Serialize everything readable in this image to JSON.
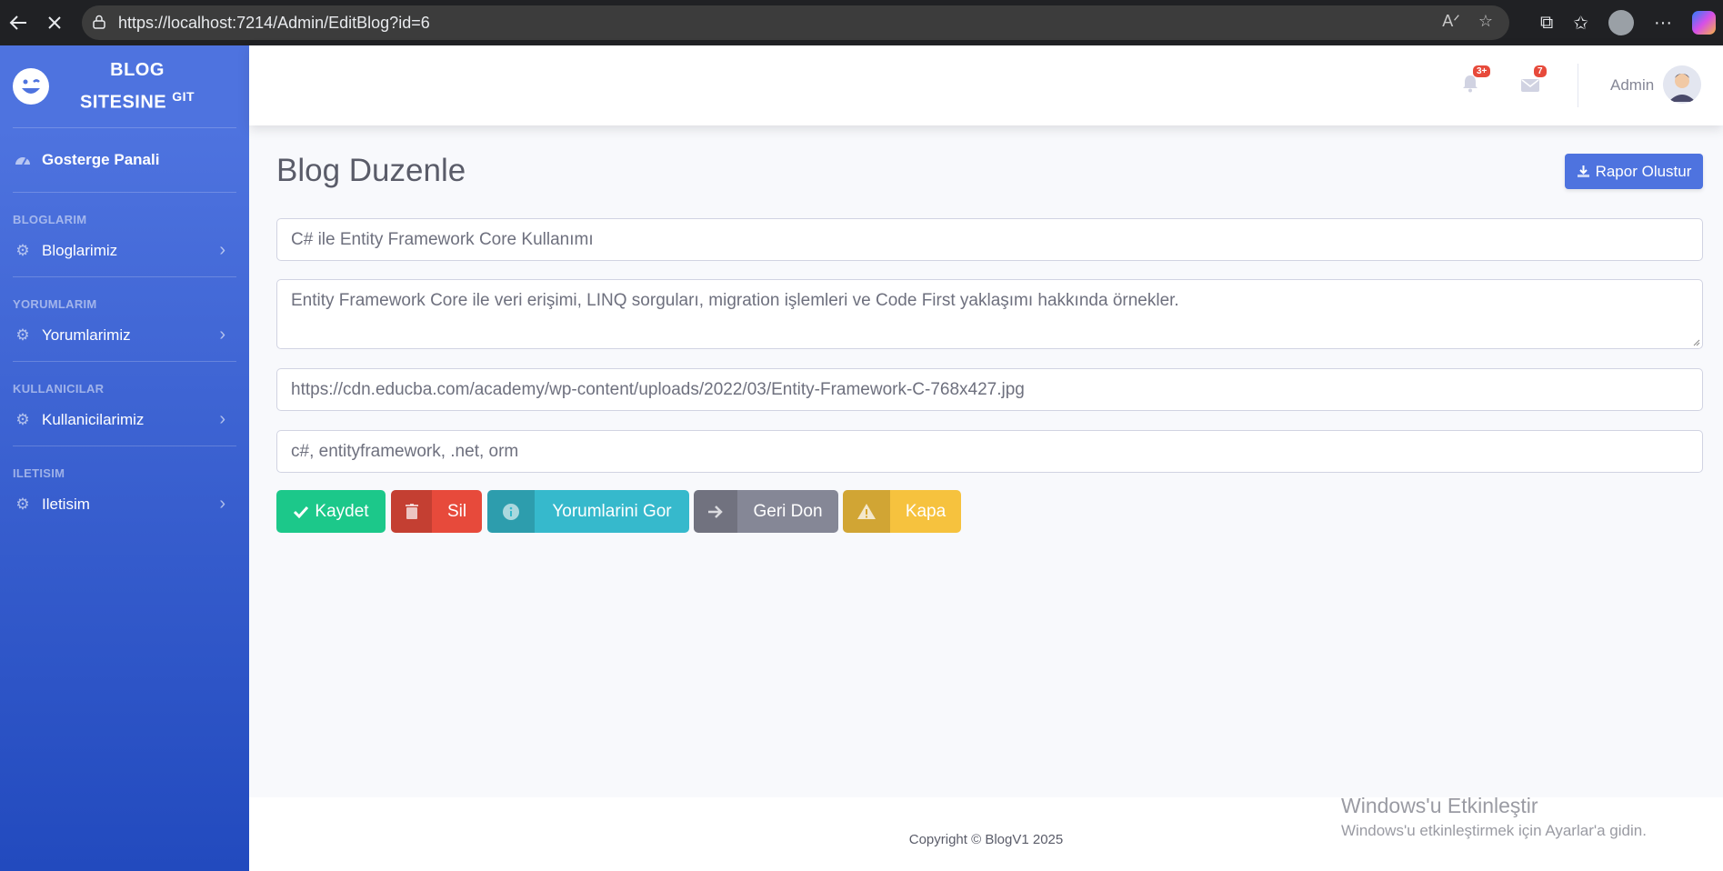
{
  "browser": {
    "url": "https://localhost:7214/Admin/EditBlog?id=6"
  },
  "sidebar": {
    "brand_line1": "BLOG",
    "brand_line2": "SITESINE",
    "brand_sup": "GIT",
    "dashboard": "Gosterge Panali",
    "sections": [
      {
        "heading": "BLOGLARIM",
        "item": "Bloglarimiz"
      },
      {
        "heading": "YORUMLARIM",
        "item": "Yorumlarimiz"
      },
      {
        "heading": "KULLANICILAR",
        "item": "Kullanicilarimiz"
      },
      {
        "heading": "ILETISIM",
        "item": "Iletisim"
      }
    ]
  },
  "topbar": {
    "alerts_badge": "3+",
    "messages_badge": "7",
    "user_name": "Admin"
  },
  "main": {
    "title": "Blog Duzenle",
    "report_button": "Rapor Olustur",
    "form": {
      "title_value": "C# ile Entity Framework Core Kullanımı",
      "content_value": "Entity Framework Core ile veri erişimi, LINQ sorguları, migration işlemleri ve Code First yaklaşımı hakkında örnekler.",
      "image_url_value": "https://cdn.educba.com/academy/wp-content/uploads/2022/03/Entity-Framework-C-768x427.jpg",
      "tags_value": "c#, entityframework, .net, orm"
    },
    "buttons": {
      "save": "Kaydet",
      "delete": "Sil",
      "comments": "Yorumlarini Gor",
      "back": "Geri Don",
      "close": "Kapa"
    }
  },
  "footer": {
    "copyright": "Copyright © BlogV1 2025"
  },
  "watermark": {
    "line1": "Windows'u Etkinleştir",
    "line2": "Windows'u etkinleştirmek için Ayarlar'a gidin."
  },
  "colors": {
    "primary": "#4e73df",
    "success": "#1cc88a",
    "danger": "#e74a3b",
    "info": "#36b9cc",
    "secondary": "#858796",
    "warning": "#f6c23e"
  }
}
